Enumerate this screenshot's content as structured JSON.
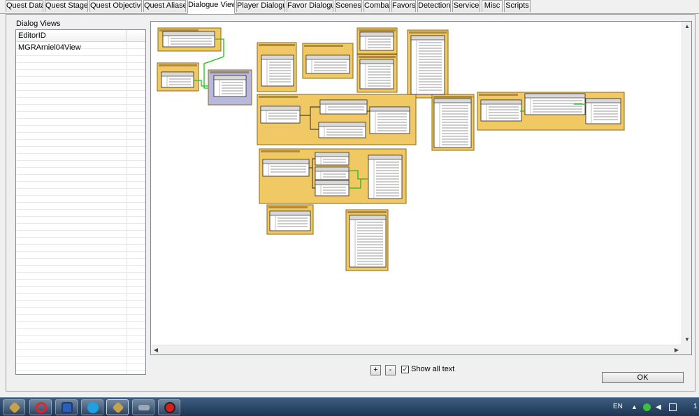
{
  "tabs": [
    {
      "label": "Quest Data"
    },
    {
      "label": "Quest Stages"
    },
    {
      "label": "Quest Objectives"
    },
    {
      "label": "Quest Aliases"
    },
    {
      "label": "Dialogue Views",
      "active": true
    },
    {
      "label": "Player Dialogue"
    },
    {
      "label": "Favor Dialogue"
    },
    {
      "label": "Scenes"
    },
    {
      "label": "Combat"
    },
    {
      "label": "Favors"
    },
    {
      "label": "Detection"
    },
    {
      "label": "Service"
    },
    {
      "label": "Misc"
    },
    {
      "label": "Scripts"
    }
  ],
  "dialog_views": {
    "label": "Dialog Views",
    "column_header": "EditorID",
    "items": [
      "MGRArniel04View"
    ]
  },
  "canvas_controls": {
    "zoom_in_label": "+",
    "zoom_out_label": "-",
    "show_all_checked": true,
    "show_all_text_label": "Show all text"
  },
  "ok_label": "OK",
  "taskbar": {
    "apps": [
      "skyrim-launcher-icon",
      "opera-icon",
      "save-disk-icon",
      "skype-icon",
      "creation-kit-icon",
      "network-icon",
      "record-icon"
    ],
    "language": "EN",
    "clock_fragment": "1"
  },
  "colors": {
    "branch_fill": "#f0c864",
    "branch_border": "#8a6a1a",
    "selected_branch_fill": "#b8b8dc",
    "connector": "#22bb22"
  }
}
